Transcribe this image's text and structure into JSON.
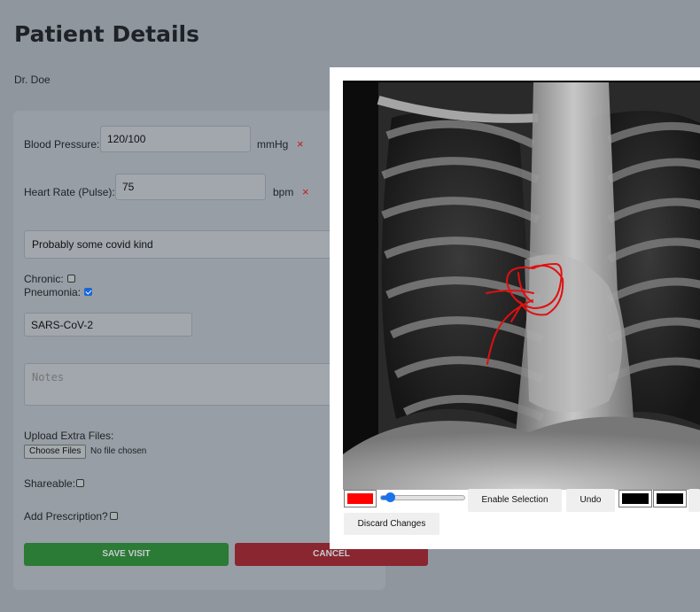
{
  "page": {
    "title": "Patient Details",
    "doctor": "Dr. Doe"
  },
  "form": {
    "bp_label": "Blood Pressure:",
    "bp_value": "120/100",
    "bp_unit": "mmHg",
    "hr_label": "Heart Rate (Pulse):",
    "hr_value": "75",
    "hr_unit": "bpm",
    "remove_glyph": "×",
    "diagnosis_value": "Probably some covid kind",
    "chronic_label": "Chronic:",
    "chronic_checked": false,
    "pneumonia_label": "Pneumonia:",
    "pneumonia_checked": true,
    "virus_value": "SARS-CoV-2",
    "notes_placeholder": "Notes",
    "upload_label": "Upload Extra Files:",
    "choose_files_label": "Choose Files",
    "no_file_text": "No file chosen",
    "shareable_label": "Shareable:",
    "shareable_checked": false,
    "prescription_label": "Add Prescription?",
    "prescription_checked": false,
    "save_label": "SAVE VISIT",
    "cancel_label": "CANCEL",
    "colors": {
      "save": "#2b7a35",
      "cancel": "#8a2630"
    }
  },
  "editor": {
    "image_icon": "chest-xray-image",
    "stroke_color": "#ff0000",
    "brush_size_fraction": 0.1,
    "enable_selection_label": "Enable Selection",
    "undo_label": "Undo",
    "discard_label": "Discard Changes",
    "swatch_colors": [
      "#000000",
      "#000000"
    ]
  }
}
